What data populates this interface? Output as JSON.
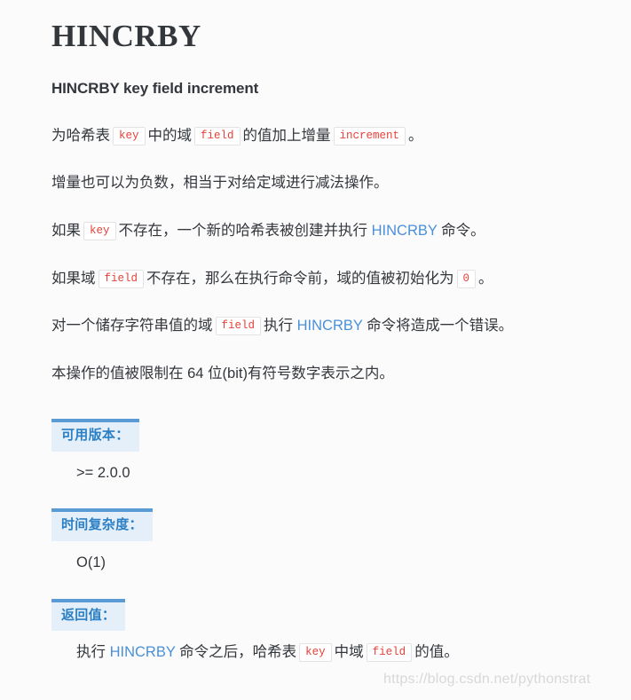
{
  "document": {
    "title": "HINCRBY",
    "syntax": "HINCRBY key field increment"
  },
  "paragraphs": [
    {
      "id": "p1",
      "segments": [
        {
          "type": "text",
          "value": "为哈希表"
        },
        {
          "type": "code",
          "value": "key"
        },
        {
          "type": "text",
          "value": "中的域"
        },
        {
          "type": "code",
          "value": "field"
        },
        {
          "type": "text",
          "value": "的值加上增量"
        },
        {
          "type": "code",
          "value": "increment"
        },
        {
          "type": "text",
          "value": "。"
        }
      ]
    },
    {
      "id": "p2",
      "segments": [
        {
          "type": "text",
          "value": "增量也可以为负数，相当于对给定域进行减法操作。"
        }
      ]
    },
    {
      "id": "p3",
      "segments": [
        {
          "type": "text",
          "value": "如果"
        },
        {
          "type": "code",
          "value": "key"
        },
        {
          "type": "text",
          "value": "不存在，一个新的哈希表被创建并执行 "
        },
        {
          "type": "link",
          "value": "HINCRBY"
        },
        {
          "type": "text",
          "value": " 命令。"
        }
      ]
    },
    {
      "id": "p4",
      "segments": [
        {
          "type": "text",
          "value": "如果域"
        },
        {
          "type": "code",
          "value": "field"
        },
        {
          "type": "text",
          "value": "不存在，那么在执行命令前，域的值被初始化为"
        },
        {
          "type": "code",
          "value": "0"
        },
        {
          "type": "text",
          "value": "。"
        }
      ]
    },
    {
      "id": "p5",
      "segments": [
        {
          "type": "text",
          "value": "对一个储存字符串值的域"
        },
        {
          "type": "code",
          "value": "field"
        },
        {
          "type": "text",
          "value": "执行 "
        },
        {
          "type": "link",
          "value": "HINCRBY"
        },
        {
          "type": "text",
          "value": " 命令将造成一个错误。"
        }
      ]
    },
    {
      "id": "p6",
      "segments": [
        {
          "type": "text",
          "value": "本操作的值被限制在 64 位(bit)有符号数字表示之内。"
        }
      ]
    }
  ],
  "sections": [
    {
      "id": "available-version",
      "heading": "可用版本：",
      "body_segments": [
        {
          "type": "text",
          "value": ">= 2.0.0"
        }
      ]
    },
    {
      "id": "time-complexity",
      "heading": "时间复杂度：",
      "body_segments": [
        {
          "type": "text",
          "value": "O(1)"
        }
      ]
    },
    {
      "id": "return-value",
      "heading": "返回值：",
      "body_segments": [
        {
          "type": "text",
          "value": "执行 "
        },
        {
          "type": "link",
          "value": "HINCRBY"
        },
        {
          "type": "text",
          "value": " 命令之后，哈希表"
        },
        {
          "type": "code",
          "value": "key"
        },
        {
          "type": "text",
          "value": "中域"
        },
        {
          "type": "code",
          "value": "field"
        },
        {
          "type": "text",
          "value": "的值。"
        }
      ]
    }
  ],
  "watermark": {
    "text": "https://blog.csdn.net/pythonstrat"
  },
  "colors": {
    "page_background": "#fbfbfb",
    "text": "#33373c",
    "link": "#4a90d9",
    "code_text": "#e8413a",
    "code_border": "#e3e3e3",
    "section_heading_text": "#2b7fc4",
    "section_heading_background": "#e4eff9",
    "section_heading_top_border": "#5b9bd5",
    "watermark": "#d8d8d8"
  }
}
